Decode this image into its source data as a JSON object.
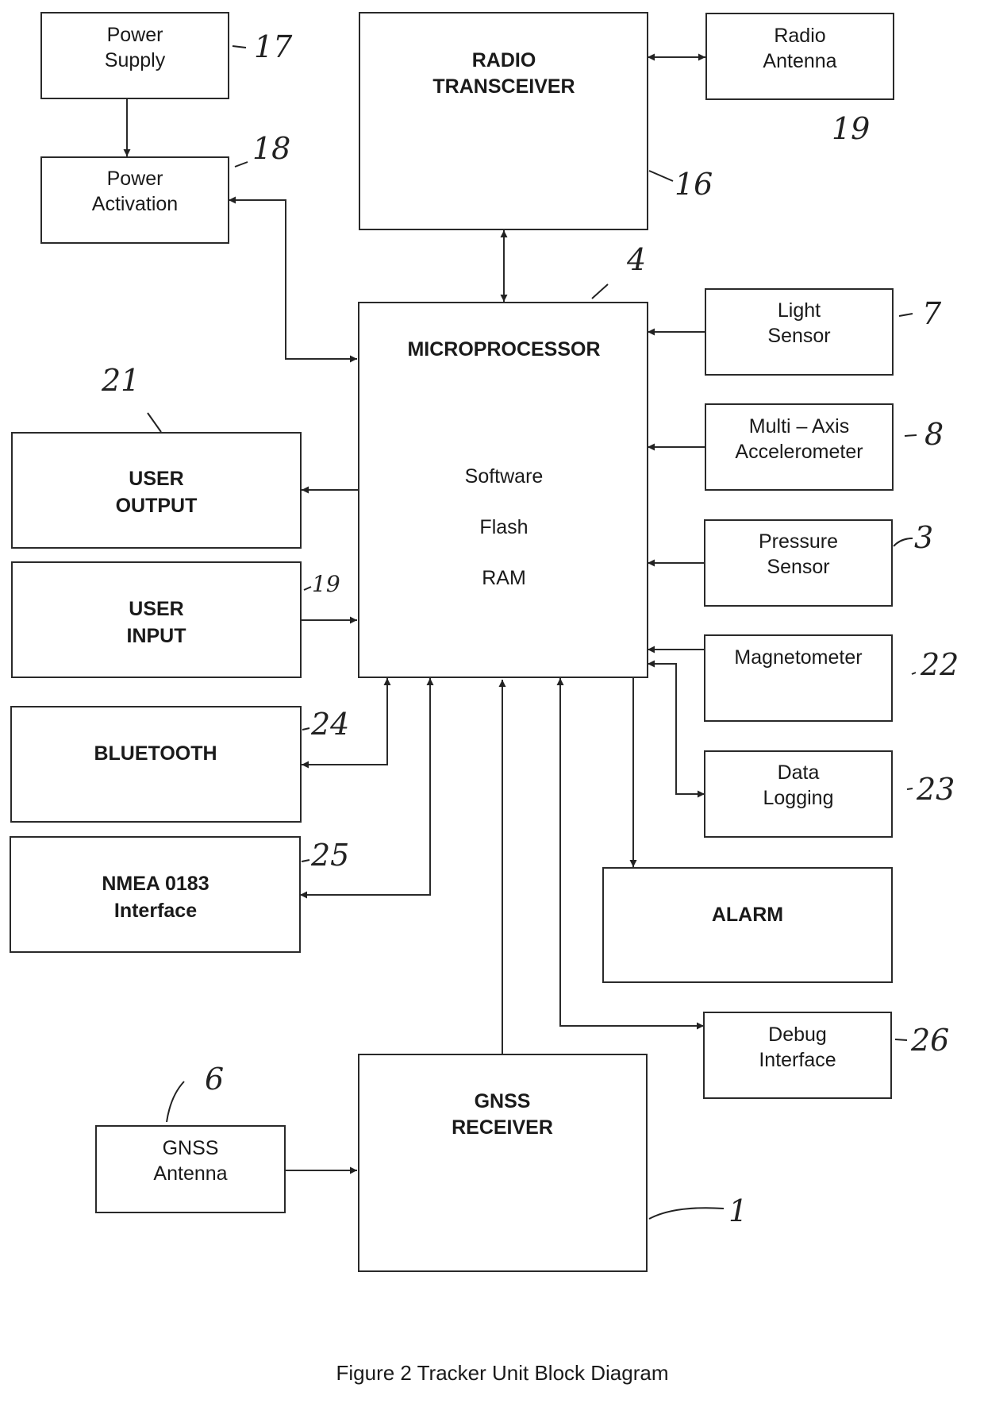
{
  "figure": {
    "caption": "Figure 2 Tracker Unit Block Diagram"
  },
  "blocks": {
    "power_supply": {
      "lines": [
        "Power",
        "Supply"
      ],
      "ref": "17",
      "style": "normal"
    },
    "power_activation": {
      "lines": [
        "Power",
        "Activation"
      ],
      "ref": "18",
      "style": "normal"
    },
    "radio_transceiver": {
      "lines": [
        "RADIO",
        "TRANSCEIVER"
      ],
      "ref": "16",
      "style": "bold"
    },
    "radio_antenna": {
      "lines": [
        "Radio",
        "Antenna"
      ],
      "ref": "19",
      "style": "normal"
    },
    "microprocessor": {
      "title": "MICROPROCESSOR",
      "items": [
        "Software",
        "Flash",
        "RAM"
      ],
      "ref": "4",
      "style": "bold"
    },
    "light_sensor": {
      "lines": [
        "Light",
        "Sensor"
      ],
      "ref": "7",
      "style": "normal"
    },
    "accelerometer": {
      "lines": [
        "Multi – Axis",
        "Accelerometer"
      ],
      "ref": "8",
      "style": "normal"
    },
    "pressure_sensor": {
      "lines": [
        "Pressure",
        "Sensor"
      ],
      "ref": "3",
      "style": "normal"
    },
    "magnetometer": {
      "lines": [
        "Magnetometer"
      ],
      "ref": "22",
      "style": "normal"
    },
    "data_logging": {
      "lines": [
        "Data",
        "Logging"
      ],
      "ref": "23",
      "style": "normal"
    },
    "alarm": {
      "lines": [
        "ALARM"
      ],
      "ref": "",
      "style": "bold"
    },
    "debug_interface": {
      "lines": [
        "Debug",
        "Interface"
      ],
      "ref": "26",
      "style": "normal"
    },
    "user_output": {
      "lines": [
        "USER",
        "OUTPUT"
      ],
      "ref": "21",
      "style": "bold"
    },
    "user_input": {
      "lines": [
        "USER",
        "INPUT"
      ],
      "ref": "19",
      "style": "bold"
    },
    "bluetooth": {
      "lines": [
        "BLUETOOTH"
      ],
      "ref": "24",
      "style": "bold"
    },
    "nmea": {
      "lines": [
        "NMEA 0183",
        "Interface"
      ],
      "ref": "25",
      "style": "bold"
    },
    "gnss_antenna": {
      "lines": [
        "GNSS",
        "Antenna"
      ],
      "ref": "6",
      "style": "normal"
    },
    "gnss_receiver": {
      "lines": [
        "GNSS",
        "RECEIVER"
      ],
      "ref": "1",
      "style": "bold"
    }
  },
  "connections": [
    {
      "from": "power_supply",
      "to": "power_activation",
      "direction": "one-way"
    },
    {
      "from": "microprocessor",
      "to": "power_activation",
      "direction": "two-way"
    },
    {
      "from": "microprocessor",
      "to": "radio_transceiver",
      "direction": "two-way"
    },
    {
      "from": "radio_transceiver",
      "to": "radio_antenna",
      "direction": "two-way"
    },
    {
      "from": "light_sensor",
      "to": "microprocessor",
      "direction": "one-way"
    },
    {
      "from": "accelerometer",
      "to": "microprocessor",
      "direction": "one-way"
    },
    {
      "from": "pressure_sensor",
      "to": "microprocessor",
      "direction": "one-way"
    },
    {
      "from": "magnetometer",
      "to": "microprocessor",
      "direction": "one-way"
    },
    {
      "from": "microprocessor",
      "to": "data_logging",
      "direction": "two-way"
    },
    {
      "from": "microprocessor",
      "to": "alarm",
      "direction": "one-way"
    },
    {
      "from": "microprocessor",
      "to": "debug_interface",
      "direction": "two-way"
    },
    {
      "from": "microprocessor",
      "to": "user_output",
      "direction": "one-way"
    },
    {
      "from": "user_input",
      "to": "microprocessor",
      "direction": "one-way"
    },
    {
      "from": "microprocessor",
      "to": "bluetooth",
      "direction": "two-way"
    },
    {
      "from": "microprocessor",
      "to": "nmea",
      "direction": "two-way"
    },
    {
      "from": "gnss_antenna",
      "to": "gnss_receiver",
      "direction": "one-way"
    },
    {
      "from": "gnss_receiver",
      "to": "microprocessor",
      "direction": "one-way"
    }
  ]
}
